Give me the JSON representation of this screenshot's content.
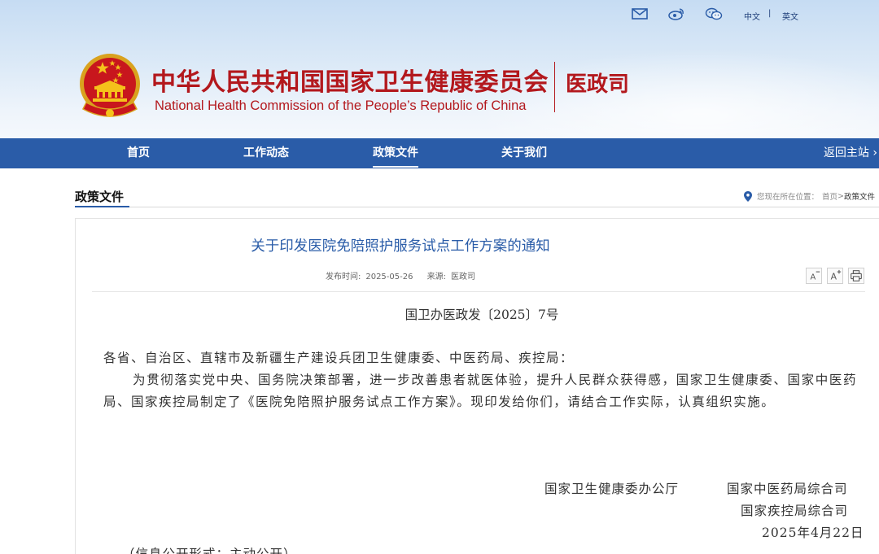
{
  "header": {
    "lang_cn": "中文",
    "lang_sep": "|",
    "lang_en": "英文",
    "org_name_cn": "中华人民共和国国家卫生健康委员会",
    "org_name_en": "National Health Commission of the People’s Republic of China",
    "dept_name": "医政司",
    "icons": [
      "mail-icon",
      "weibo-icon",
      "wechat-icon",
      "national-emblem"
    ]
  },
  "nav": {
    "items": [
      {
        "label": "首页"
      },
      {
        "label": "工作动态"
      },
      {
        "label": "政策文件"
      },
      {
        "label": "关于我们"
      }
    ],
    "active": "政策文件",
    "return_label": "返回主站 ›"
  },
  "section": {
    "title": "政策文件",
    "crumb_prefix": "您现在所在位置：",
    "crumb_home": "首页",
    "crumb_sep": ">",
    "crumb_current": "政策文件"
  },
  "article": {
    "title": "关于印发医院免陪照护服务试点工作方案的通知",
    "publish_label": "发布时间:",
    "publish_date": "2025-05-26",
    "source_label": "来源:",
    "source": "医政司",
    "tools": [
      "font-decrease-icon",
      "font-increase-icon",
      "print-icon"
    ],
    "doc_number": "国卫办医政发〔2025〕7号",
    "salutation": "各省、自治区、直辖市及新疆生产建设兵团卫生健康委、中医药局、疾控局：",
    "body": "为贯彻落实党中央、国务院决策部署，进一步改善患者就医体验，提升人民群众获得感，国家卫生健康委、国家中医药局、国家疾控局制定了《医院免陪照护服务试点工作方案》。现印发给你们，请结合工作实际，认真组织实施。",
    "signer1": "国家卫生健康委办公厅",
    "signer2": "国家中医药局综合司",
    "signer3": "国家疾控局综合司",
    "sign_date": "2025年4月22日",
    "disclosure": "（信息公开形式：主动公开）"
  },
  "colors": {
    "brand_red": "#b3181d",
    "nav_blue": "#2a5ca8",
    "link_blue": "#2a5ca8"
  }
}
